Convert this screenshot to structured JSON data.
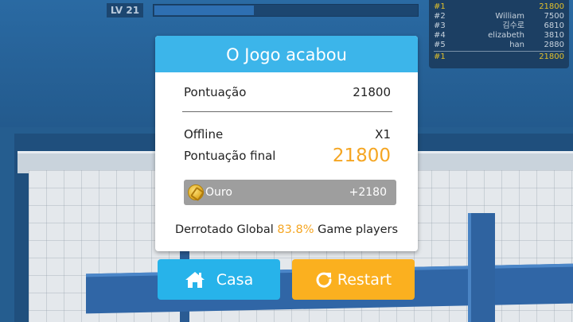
{
  "hud": {
    "level": "LV 21",
    "xp_progress": 0.38
  },
  "leaderboard": {
    "rows": [
      {
        "rank": "#1",
        "name": "",
        "score": "21800"
      },
      {
        "rank": "#2",
        "name": "William",
        "score": "7500"
      },
      {
        "rank": "#3",
        "name": "김수로",
        "score": "6810"
      },
      {
        "rank": "#4",
        "name": "elizabeth",
        "score": "3810"
      },
      {
        "rank": "#5",
        "name": "han",
        "score": "2880"
      }
    ],
    "self": {
      "rank": "#1",
      "name": "",
      "score": "21800"
    }
  },
  "dialog": {
    "title": "O Jogo acabou",
    "score_label": "Pontuação",
    "score_value": "21800",
    "offline_label": "Offline",
    "offline_value": "X1",
    "final_label": "Pontuação final",
    "final_value": "21800",
    "gold_label": "Ouro",
    "gold_value": "+2180",
    "defeat_prefix": "Derrotado Global",
    "defeat_pct": "83.8%",
    "defeat_suffix": "Game players"
  },
  "buttons": {
    "home_label": "Casa",
    "restart_label": "Restart"
  },
  "colors": {
    "header": "#3cb5ea",
    "accent_orange": "#f5a623",
    "home_button": "#27b3ea",
    "restart_button": "#fbb01f",
    "leader_gold": "#e2c02a"
  },
  "icons": {
    "home": "house-icon",
    "restart": "restart-icon",
    "gold": "coin-icon"
  }
}
